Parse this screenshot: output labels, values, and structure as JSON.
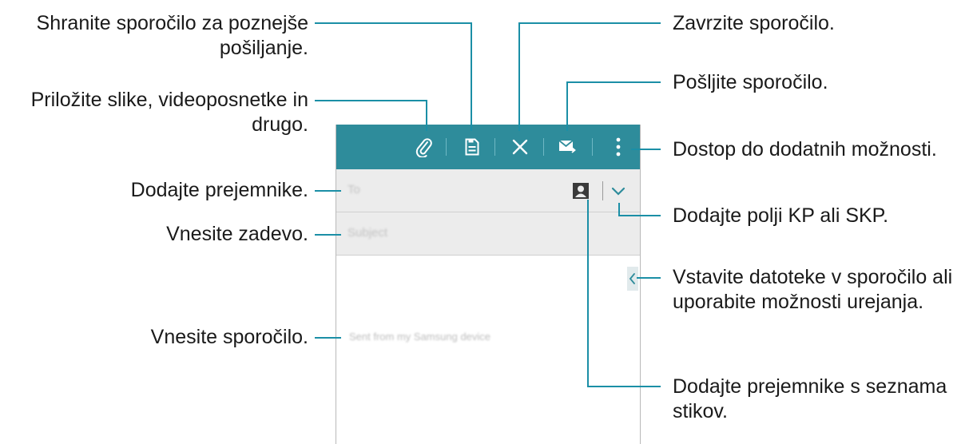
{
  "callouts": {
    "save": [
      "Shranite sporočilo za poznejše",
      "pošiljanje."
    ],
    "attach": [
      "Priložite slike, videoposnetke in",
      "drugo."
    ],
    "recipients": "Dodajte prejemnike.",
    "subject": "Vnesite zadevo.",
    "message": "Vnesite sporočilo.",
    "discard": "Zavrzite sporočilo.",
    "send": "Pošljite sporočilo.",
    "more": "Dostop do dodatnih možnosti.",
    "cc_bcc": "Dodajte polji KP ali SKP.",
    "insert": [
      "Vstavite datoteke v sporočilo ali",
      "uporabite možnosti urejanja."
    ],
    "contacts": [
      "Dodajte prejemnike s seznama",
      "stikov."
    ]
  },
  "compose": {
    "to_placeholder": "To",
    "subject_placeholder": "Subject",
    "signature": "Sent from my Samsung device"
  },
  "colors": {
    "toolbar": "#2e8c9b",
    "leader": "#1b8fa6"
  },
  "icons": [
    "paperclip-icon",
    "save-icon",
    "close-icon",
    "send-icon",
    "more-icon",
    "contact-icon",
    "chevron-down-icon",
    "chevron-left-icon"
  ]
}
